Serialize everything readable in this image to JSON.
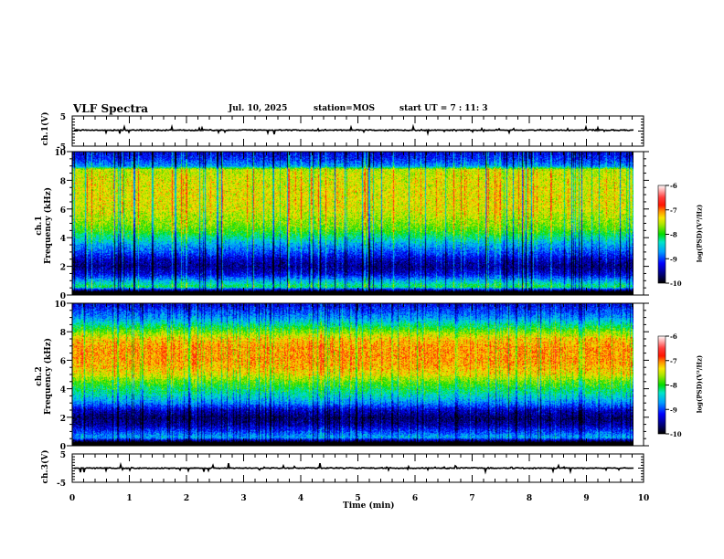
{
  "header": {
    "title": "VLF Spectra",
    "date": "Jul. 10, 2025",
    "station": "station=MOS",
    "start_time": "start UT =  7 : 11: 3"
  },
  "chart_data": [
    {
      "type": "line",
      "name": "ch1-waveform",
      "ylabel": "ch.1(V)",
      "ylim": [
        -5,
        5
      ],
      "yticks": [
        "5",
        "-5"
      ],
      "xlim": [
        0,
        10
      ],
      "approx_level": 0.3,
      "data_end_min": 9.83
    },
    {
      "type": "heatmap",
      "name": "ch1-spectrogram",
      "ylabel_top": "ch.1",
      "ylabel": "Frequency (kHz)",
      "ylim": [
        0,
        10
      ],
      "yticks": [
        "0",
        "2",
        "4",
        "6",
        "8",
        "10"
      ],
      "xlim": [
        0,
        10
      ],
      "data_end_min": 9.83,
      "colorbar": {
        "label": "log(PSD)(V²/Hz)",
        "range": [
          -10,
          -6
        ],
        "ticks": [
          "-6",
          "-7",
          "-8",
          "-9",
          "-10"
        ]
      },
      "approx_mean_log_psd_profile": {
        "freq_khz": [
          0,
          0.3,
          0.6,
          1.0,
          1.5,
          2.0,
          2.5,
          3.0,
          3.5,
          4.0,
          4.5,
          5,
          6,
          7,
          8,
          8.8,
          9.0,
          9.5,
          10
        ],
        "log_psd": [
          -10,
          -10,
          -8.1,
          -8.6,
          -9.3,
          -9.6,
          -9.4,
          -9.0,
          -8.7,
          -8.3,
          -7.9,
          -7.7,
          -7.45,
          -7.4,
          -7.45,
          -7.55,
          -8.7,
          -9.1,
          -9.3
        ]
      }
    },
    {
      "type": "heatmap",
      "name": "ch2-spectrogram",
      "ylabel_top": "ch.2",
      "ylabel": "Frequency (kHz)",
      "ylim": [
        0,
        10
      ],
      "yticks": [
        "0",
        "2",
        "4",
        "6",
        "8",
        "10"
      ],
      "xlim": [
        0,
        10
      ],
      "data_end_min": 9.83,
      "colorbar": {
        "label": "log(PSD)(V²/Hz)",
        "range": [
          -10,
          -6
        ],
        "ticks": [
          "-6",
          "-7",
          "-8",
          "-9",
          "-10"
        ]
      },
      "approx_mean_log_psd_profile": {
        "freq_khz": [
          0,
          0.3,
          0.6,
          1.0,
          1.5,
          2.0,
          2.5,
          3.0,
          3.5,
          4.0,
          4.5,
          5,
          5.5,
          6,
          7,
          7.5,
          8,
          8.5,
          9,
          9.5,
          10
        ],
        "log_psd": [
          -10,
          -10,
          -8.6,
          -9.0,
          -9.5,
          -9.7,
          -9.4,
          -8.8,
          -8.4,
          -8.1,
          -7.8,
          -7.4,
          -7.2,
          -7.1,
          -7.1,
          -7.25,
          -7.7,
          -8.2,
          -8.7,
          -9.0,
          -9.3
        ]
      }
    },
    {
      "type": "line",
      "name": "ch3-waveform",
      "ylabel": "ch.3(V)",
      "ylim": [
        -5,
        5
      ],
      "yticks": [
        "5",
        "-5"
      ],
      "xlim": [
        0,
        10
      ],
      "approx_level": 0,
      "data_end_min": 9.83,
      "xlabel": "Time (min)",
      "xticks": [
        "0",
        "1",
        "2",
        "3",
        "4",
        "5",
        "6",
        "7",
        "8",
        "9",
        "10"
      ]
    }
  ]
}
